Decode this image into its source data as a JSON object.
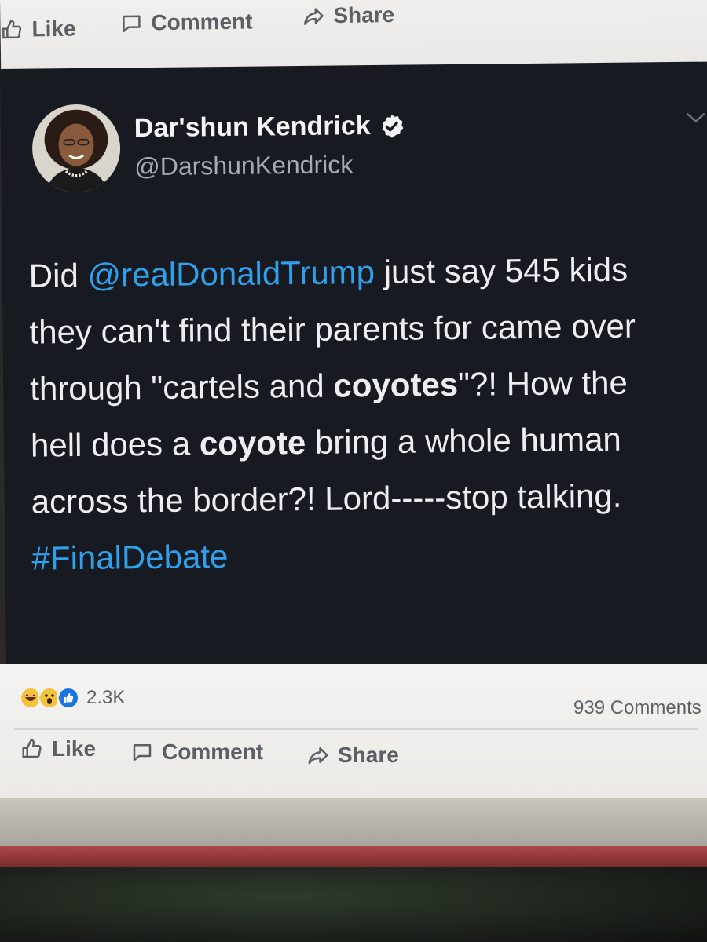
{
  "top_actions": {
    "like": "Like",
    "comment": "Comment",
    "share": "Share"
  },
  "tweet": {
    "display_name": "Dar'shun Kendrick",
    "handle": "@DarshunKendrick",
    "text": {
      "p1": "Did ",
      "mention": "@realDonaldTrump",
      "p2": " just say 545 kids they can't find their parents for came over through \"cartels and ",
      "b1": "coyotes",
      "p3": "\"?! How the hell does a ",
      "b2": "coyote",
      "p4": " bring a whole human across the border?!  Lord-----stop talking. ",
      "hashtag": "#FinalDebate"
    },
    "colors": {
      "background": "#171a20",
      "link": "#2fa0ec",
      "text": "#eceef1"
    }
  },
  "engagement": {
    "reactions": [
      "haha",
      "wow",
      "like"
    ],
    "reaction_count": "2.3K",
    "comments": "939 Comments"
  },
  "bottom_actions": {
    "like": "Like",
    "comment": "Comment",
    "share": "Share"
  }
}
